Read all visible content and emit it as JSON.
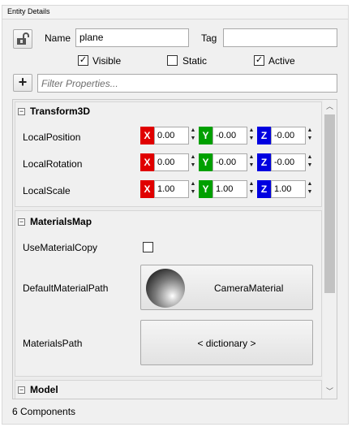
{
  "panel_title": "Entity Details",
  "entity": {
    "name_label": "Name",
    "name_value": "plane",
    "tag_label": "Tag",
    "tag_value": "",
    "visible_label": "Visible",
    "visible_checked": true,
    "static_label": "Static",
    "static_checked": false,
    "active_label": "Active",
    "active_checked": true
  },
  "filter_placeholder": "Filter Properties...",
  "transform": {
    "title": "Transform3D",
    "rows": [
      {
        "label": "LocalPosition",
        "x": "0.00",
        "y": "-0.00",
        "z": "-0.00"
      },
      {
        "label": "LocalRotation",
        "x": "0.00",
        "y": "-0.00",
        "z": "-0.00"
      },
      {
        "label": "LocalScale",
        "x": "1.00",
        "y": "1.00",
        "z": "1.00"
      }
    ],
    "axis_labels": {
      "x": "X",
      "y": "Y",
      "z": "Z"
    }
  },
  "materials": {
    "title": "MaterialsMap",
    "use_copy_label": "UseMaterialCopy",
    "use_copy_checked": false,
    "default_path_label": "DefaultMaterialPath",
    "default_path_value": "CameraMaterial",
    "paths_label": "MaterialsPath",
    "paths_value": "< dictionary >"
  },
  "model": {
    "title": "Model"
  },
  "footer": "6 Components",
  "colors": {
    "x_axis": "#e00000",
    "y_axis": "#00a000",
    "z_axis": "#0000e0"
  }
}
